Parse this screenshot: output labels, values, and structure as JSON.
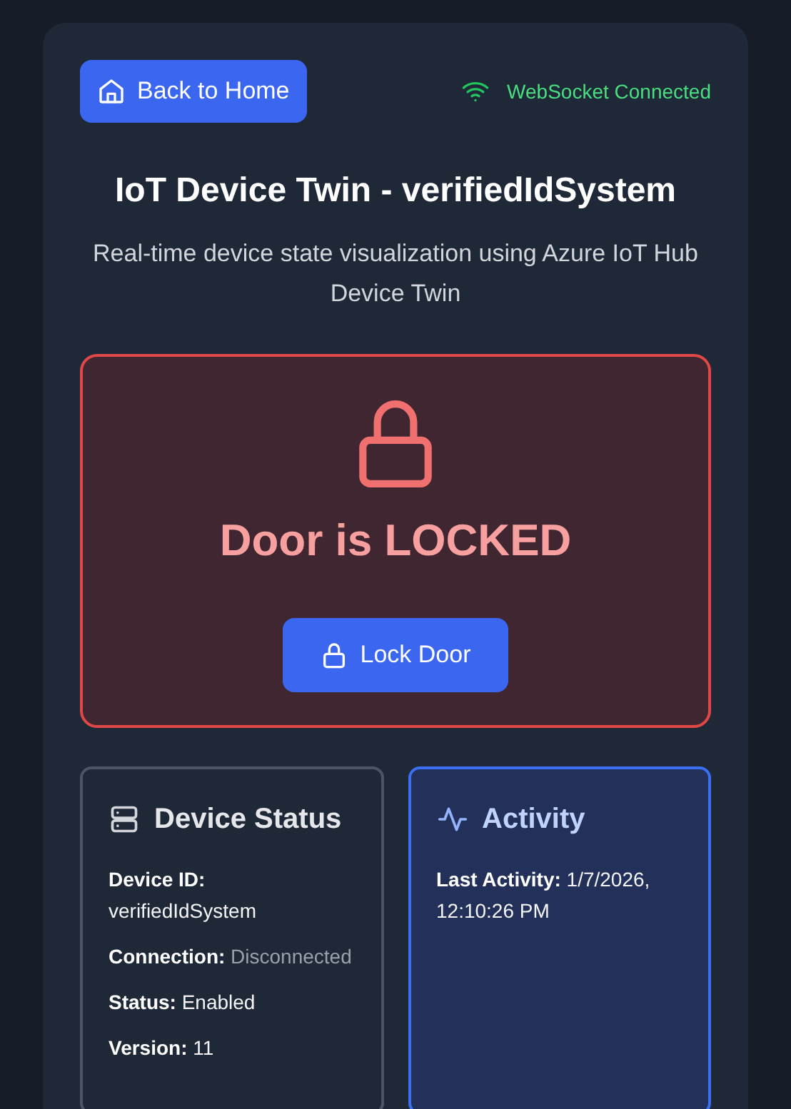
{
  "back_button": {
    "label": "Back to Home"
  },
  "websocket": {
    "label": "WebSocket Connected",
    "connected": true
  },
  "title": "IoT Device Twin - verifiedIdSystem",
  "subtitle": "Real-time device state visualization using Azure IoT Hub Device Twin",
  "door": {
    "locked": true,
    "status": "Door is LOCKED",
    "button": "Lock Door"
  },
  "device_status": {
    "title": "Device Status",
    "fields": [
      {
        "label": "Device ID:",
        "value": "verifiedIdSystem",
        "muted": false
      },
      {
        "label": "Connection:",
        "value": "Disconnected",
        "muted": true
      },
      {
        "label": "Status:",
        "value": "Enabled",
        "muted": false
      },
      {
        "label": "Version:",
        "value": "11",
        "muted": false
      }
    ]
  },
  "activity": {
    "title": "Activity",
    "fields": [
      {
        "label": "Last Activity:",
        "value": "1/7/2026, 12:10:26 PM",
        "muted": false
      }
    ]
  }
}
